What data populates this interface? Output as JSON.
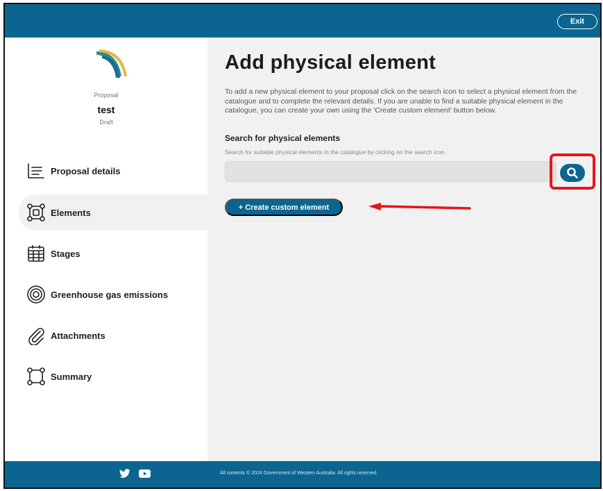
{
  "header": {
    "exit_label": "Exit"
  },
  "proposal": {
    "label": "Proposal",
    "name": "test",
    "status": "Draft"
  },
  "nav": {
    "items": [
      {
        "label": "Proposal details",
        "icon": "list-icon",
        "active": false
      },
      {
        "label": "Elements",
        "icon": "elements-icon",
        "active": true
      },
      {
        "label": "Stages",
        "icon": "calendar-icon",
        "active": false
      },
      {
        "label": "Greenhouse gas emissions",
        "icon": "target-icon",
        "active": false
      },
      {
        "label": "Attachments",
        "icon": "paperclip-icon",
        "active": false
      },
      {
        "label": "Summary",
        "icon": "summary-icon",
        "active": false
      }
    ]
  },
  "main": {
    "title": "Add physical element",
    "intro": "To add a new physical element to your proposal click on the search icon to select a physical element from the catalogue and to complete the relevant details. If you are unable to find a suitable physical element in the catalogue, you can create your own using the 'Create custom element' button below.",
    "search_title": "Search for physical elements",
    "search_hint": "Search for suitable physical elements in the catalogue by clicking on the search icon.",
    "search_value": "",
    "create_button": "+ Create custom element"
  },
  "footer": {
    "copyright": "All contents © 2024 Government of Western Australia. All rights reserved.",
    "social": [
      "twitter-icon",
      "youtube-icon"
    ]
  },
  "colors": {
    "brand": "#0b6590",
    "highlight": "#e8141b",
    "background": "#f1f1f1"
  }
}
